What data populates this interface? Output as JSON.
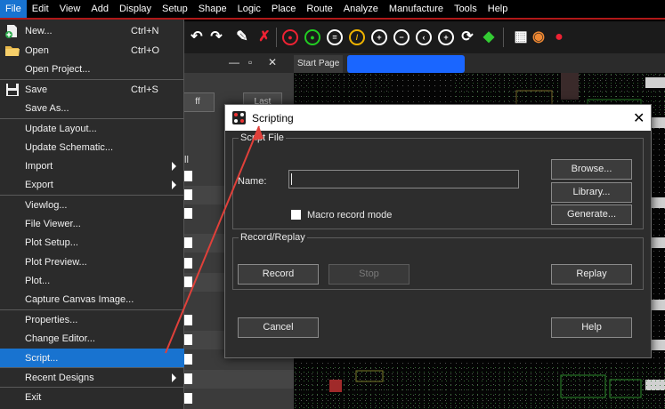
{
  "menubar": {
    "items": [
      {
        "label": "File",
        "active": true
      },
      {
        "label": "Edit"
      },
      {
        "label": "View"
      },
      {
        "label": "Add"
      },
      {
        "label": "Display"
      },
      {
        "label": "Setup"
      },
      {
        "label": "Shape"
      },
      {
        "label": "Logic"
      },
      {
        "label": "Place"
      },
      {
        "label": "Route"
      },
      {
        "label": "Analyze"
      },
      {
        "label": "Manufacture"
      },
      {
        "label": "Tools"
      },
      {
        "label": "Help"
      }
    ]
  },
  "file_menu": {
    "items": [
      {
        "label": "New...",
        "shortcut": "Ctrl+N",
        "icon": "new-file-icon"
      },
      {
        "label": "Open",
        "shortcut": "Ctrl+O",
        "icon": "folder-icon"
      },
      {
        "label": "Open Project..."
      },
      {
        "label": "Save",
        "shortcut": "Ctrl+S",
        "icon": "save-icon"
      },
      {
        "label": "Save As..."
      },
      {
        "label": "Update Layout..."
      },
      {
        "label": "Update Schematic..."
      },
      {
        "label": "Import",
        "submenu": true
      },
      {
        "label": "Export",
        "submenu": true
      },
      {
        "label": "Viewlog..."
      },
      {
        "label": "File Viewer..."
      },
      {
        "label": "Plot Setup..."
      },
      {
        "label": "Plot Preview..."
      },
      {
        "label": "Plot..."
      },
      {
        "label": "Capture Canvas Image..."
      },
      {
        "label": "Properties..."
      },
      {
        "label": "Change Editor..."
      },
      {
        "label": "Script...",
        "highlighted": true
      },
      {
        "label": "Recent Designs",
        "submenu": true
      },
      {
        "label": "Exit"
      }
    ]
  },
  "side_panel": {
    "button_left": "ff",
    "button_right": "Last",
    "column_header": "ll"
  },
  "canvas": {
    "tab_label": "Start Page"
  },
  "dialog": {
    "title": "Scripting",
    "script_file": {
      "group_label": "Script File",
      "name_label": "Name:",
      "name_value": "",
      "macro_label": "Macro record mode",
      "macro_checked": false,
      "browse_label": "Browse...",
      "library_label": "Library...",
      "generate_label": "Generate..."
    },
    "record_replay": {
      "group_label": "Record/Replay",
      "record_label": "Record",
      "stop_label": "Stop",
      "replay_label": "Replay"
    },
    "cancel_label": "Cancel",
    "help_label": "Help"
  },
  "colors": {
    "menu_highlight": "#1873d0",
    "menubar_underline": "#b01818",
    "annotation_arrow": "#e0403a",
    "tab_blue": "#1a66ff"
  }
}
